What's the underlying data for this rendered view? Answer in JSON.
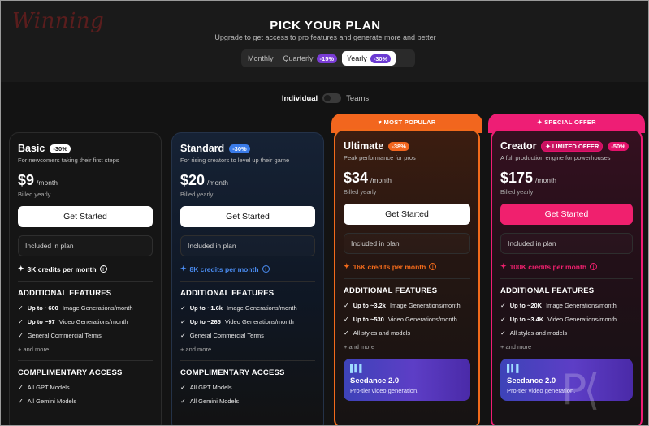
{
  "brand": {
    "logo_text": "Winning"
  },
  "header": {
    "title": "PICK YOUR PLAN",
    "subtitle": "Upgrade to get access to pro features and generate more and better",
    "billing": [
      {
        "label": "Monthly",
        "badge": ""
      },
      {
        "label": "Quarterly",
        "badge": "-15%"
      },
      {
        "label": "Yearly",
        "badge": "-30%",
        "active": true
      }
    ]
  },
  "audience": {
    "individual": "Individual",
    "teams": "Teams",
    "selected": "Individual"
  },
  "banners": {
    "ultimate": "MOST POPULAR",
    "creator": "SPECIAL OFFER"
  },
  "plans": [
    {
      "name": "Basic",
      "badge": "-30%",
      "desc": "For newcomers taking their first steps",
      "price": "$9",
      "per": "/month",
      "billed": "Billed yearly",
      "cta": "Get Started",
      "included": "Included in plan",
      "credits": "3K credits per month",
      "features_title": "ADDITIONAL FEATURES",
      "features": [
        {
          "bold": "Up to ~600",
          "text": "Image Generations/month"
        },
        {
          "bold": "Up to ~97",
          "text": "Video Generations/month"
        },
        {
          "bold": "",
          "text": "General Commercial Terms"
        }
      ],
      "more": "+ and more",
      "comp_title": "COMPLIMENTARY ACCESS",
      "comp": [
        "All GPT Models",
        "All Gemini Models"
      ]
    },
    {
      "name": "Standard",
      "badge": "-30%",
      "desc": "For rising creators to level up their game",
      "price": "$20",
      "per": "/month",
      "billed": "Billed yearly",
      "cta": "Get Started",
      "included": "Included in plan",
      "credits": "8K credits per month",
      "features_title": "ADDITIONAL FEATURES",
      "features": [
        {
          "bold": "Up to ~1.6k",
          "text": "Image Generations/month"
        },
        {
          "bold": "Up to ~265",
          "text": "Video Generations/month"
        },
        {
          "bold": "",
          "text": "General Commercial Terms"
        }
      ],
      "more": "+ and more",
      "comp_title": "COMPLIMENTARY ACCESS",
      "comp": [
        "All GPT Models",
        "All Gemini Models"
      ]
    },
    {
      "name": "Ultimate",
      "badge": "-38%",
      "desc": "Peak performance for pros",
      "price": "$34",
      "per": "/month",
      "billed": "Billed yearly",
      "cta": "Get Started",
      "included": "Included in plan",
      "credits": "16K credits per month",
      "features_title": "ADDITIONAL FEATURES",
      "features": [
        {
          "bold": "Up to ~3.2k",
          "text": "Image Generations/month"
        },
        {
          "bold": "Up to ~530",
          "text": "Video Generations/month"
        },
        {
          "bold": "",
          "text": "All styles and models"
        }
      ],
      "more": "+ and more",
      "promo": {
        "title": "Seedance 2.0",
        "sub": "Pro-tier video generation."
      }
    },
    {
      "name": "Creator",
      "badge": "LIMITED OFFER",
      "badge2": "-50%",
      "desc": "A full production engine for powerhouses",
      "price": "$175",
      "per": "/month",
      "billed": "Billed yearly",
      "cta": "Get Started",
      "included": "Included in plan",
      "credits": "100K credits per month",
      "features_title": "ADDITIONAL FEATURES",
      "features": [
        {
          "bold": "Up to ~20K",
          "text": "Image Generations/month"
        },
        {
          "bold": "Up to ~3.4K",
          "text": "Video Generations/month"
        },
        {
          "bold": "",
          "text": "All styles and models"
        }
      ],
      "more": "+ and more",
      "promo": {
        "title": "Seedance 2.0",
        "sub": "Pro-tier video generation."
      }
    }
  ],
  "colors": {
    "accent_blue": "#3a7be8",
    "accent_orange": "#f2661e",
    "accent_pink": "#f0206e",
    "discount_purple": "#6b3ad3"
  }
}
